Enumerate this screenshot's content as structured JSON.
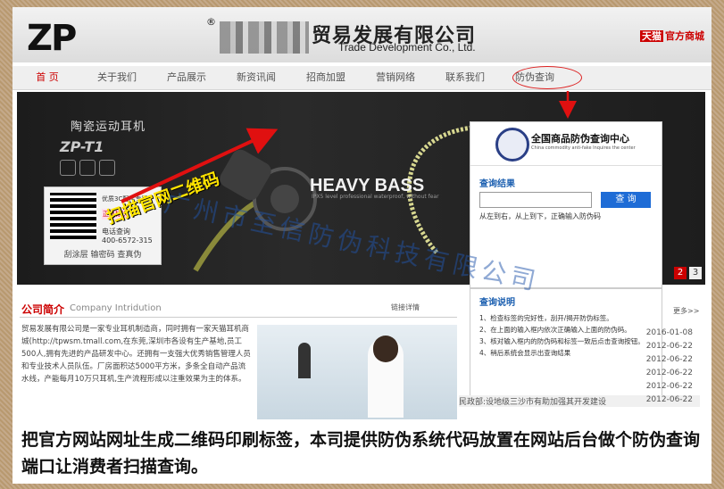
{
  "header": {
    "logo": "ZP",
    "logo_mark": "®",
    "company_cn": "贸易发展有限公司",
    "company_en": "Trade Development Co., Ltd.",
    "tmall_badge": "天猫",
    "tmall_text": "官方商城"
  },
  "nav": {
    "items": [
      "首 页",
      "关于我们",
      "产品展示",
      "新资讯闻",
      "招商加盟",
      "营销网络",
      "联系我们",
      "防伪查询"
    ]
  },
  "banner": {
    "title": "陶瓷运动耳机",
    "model": "ZP-T1",
    "slogan": "HEAVY BASS",
    "slogan_sub": "IPX5 level professional waterproof, without fear",
    "scan_label": "扫描官网二维码",
    "qr_brand": "优质3C配件专家",
    "qr_text": "正品标识",
    "qr_phone_label": "电话查询",
    "qr_phone": "400-6572-315",
    "qr_foot": "刮涂层 输密码 查真伪",
    "pages": [
      "2",
      "3"
    ]
  },
  "query": {
    "title": "全国商品防伪查询中心",
    "subtitle": "China commodity anti-fake Inquires the center",
    "result_label": "查询结果",
    "button": "查 询",
    "hint": "从左到右，从上到下，正确输入防伪码",
    "guide_label": "查询说明",
    "steps": [
      "1、检查标签的完好性，刮开/揭开防伪标签。",
      "2、在上面的输入框内依次正确输入上面的防伪码。",
      "3、核对输入框内的防伪码和标签一致后点击查询按钮。",
      "4、稍后系统会显示出查询结果"
    ]
  },
  "intro": {
    "title": "公司简介",
    "title_en": "Company Intridution",
    "more": "链接详情",
    "text": "贸易发展有限公司是一家专业耳机制造商，同时拥有一家天猫耳机商城(http://tpwsm.tmall.com,在东莞,深圳市各设有生产基地,员工500人,拥有先进的产品研发中心。还拥有一支强大优秀销售管理人员和专业技术人员队伍。厂房面积达5000平方米，多条全自动产品流水线，产能每月10万只耳机,生产流程形成以注重效果为主的体系。"
  },
  "news": {
    "more": "更多>>",
    "rows": [
      {
        "title": "",
        "date": "2016-01-08"
      },
      {
        "title": "",
        "date": "2012-06-22"
      },
      {
        "title": "",
        "date": "2012-06-22"
      },
      {
        "title": "",
        "date": "2012-06-22"
      },
      {
        "title": "",
        "date": "2012-06-22"
      },
      {
        "title": "民政部:设地级三沙市有助加强其开发建设",
        "date": "2012-06-22"
      }
    ]
  },
  "watermark": "广州市至信防伪科技有限公司",
  "caption": "把官方网站网址生成二维码印刷标签，本司提供防伪系统代码放置在网站后台做个防伪查询端口让消费者扫描查询。",
  "colors": {
    "accent": "#cc0000",
    "query_blue": "#1e6cd6"
  }
}
